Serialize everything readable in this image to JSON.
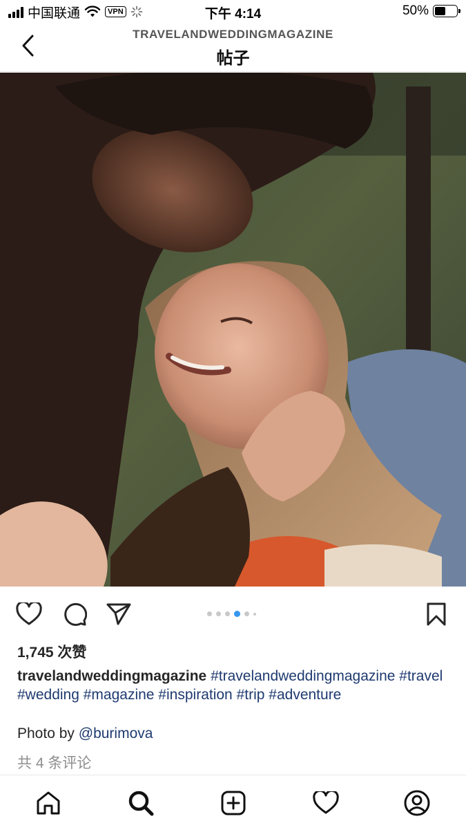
{
  "status_bar": {
    "carrier": "中国联通",
    "vpn": "VPN",
    "time": "下午 4:14",
    "battery": "50%",
    "battery_level": 0.5
  },
  "header": {
    "account": "TRAVELANDWEDDINGMAGAZINE",
    "title": "帖子"
  },
  "post": {
    "image_icon": "photo-of-smiling-couple",
    "carousel": {
      "total": 6,
      "active_index": 3
    },
    "likes": "1,745 次赞",
    "caption": {
      "username": "travelandweddingmagazine",
      "tags": [
        "#travelandweddingmagazine",
        "#travel",
        "#wedding",
        "#magazine",
        "#inspiration",
        "#trip",
        "#adventure"
      ]
    },
    "photo_credit": {
      "prefix": "Photo by",
      "mention": "@burimova"
    },
    "comments_link": "共 4 条评论"
  },
  "icons": {
    "back": "chevron-left-icon",
    "like": "heart-icon",
    "comment": "speech-bubble-icon",
    "share": "paper-plane-icon",
    "save": "bookmark-icon",
    "nav_home": "home-icon",
    "nav_search": "search-icon",
    "nav_create": "plus-square-icon",
    "nav_activity": "heart-icon",
    "nav_profile": "profile-icon"
  },
  "colors": {
    "accent": "#3797f0",
    "link": "#1e3a70",
    "muted": "#8e8e8e"
  }
}
